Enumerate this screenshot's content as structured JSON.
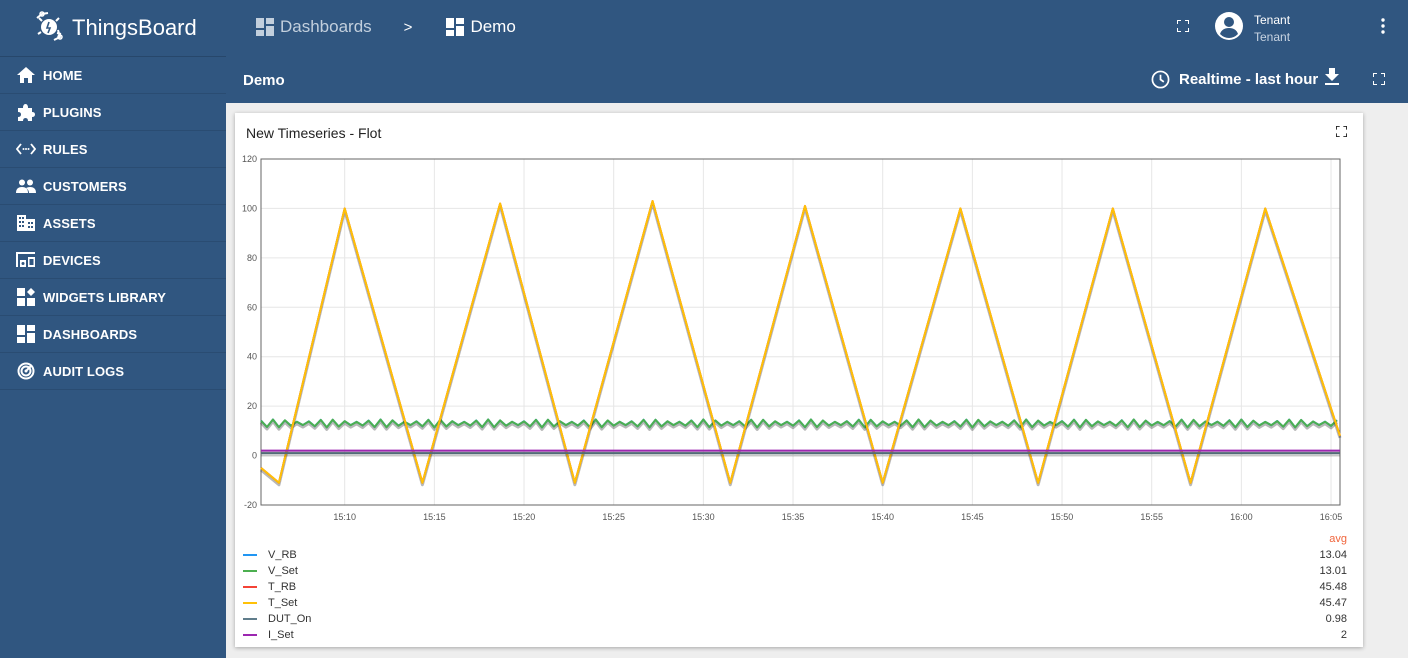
{
  "app": {
    "name": "ThingsBoard"
  },
  "sidebar": {
    "items": [
      {
        "label": "HOME",
        "icon": "home-icon"
      },
      {
        "label": "PLUGINS",
        "icon": "puzzle-icon"
      },
      {
        "label": "RULES",
        "icon": "code-arrows-icon"
      },
      {
        "label": "CUSTOMERS",
        "icon": "people-icon"
      },
      {
        "label": "ASSETS",
        "icon": "building-icon"
      },
      {
        "label": "DEVICES",
        "icon": "devices-icon"
      },
      {
        "label": "WIDGETS LIBRARY",
        "icon": "widgets-icon"
      },
      {
        "label": "DASHBOARDS",
        "icon": "dashboard-icon"
      },
      {
        "label": "AUDIT LOGS",
        "icon": "track-changes-icon"
      }
    ]
  },
  "header": {
    "breadcrumb": [
      {
        "label": "Dashboards"
      },
      {
        "label": "Demo"
      }
    ],
    "breadcrumb_separator": ">",
    "user": {
      "name": "Tenant",
      "role": "Tenant"
    },
    "page_title": "Demo",
    "timewindow": "Realtime - last hour"
  },
  "widget": {
    "title": "New Timeseries - Flot",
    "legend_header": "avg",
    "legend": [
      {
        "name": "V_RB",
        "color": "#2196f3",
        "avg": "13.04"
      },
      {
        "name": "V_Set",
        "color": "#4caf50",
        "avg": "13.01"
      },
      {
        "name": "T_RB",
        "color": "#f44336",
        "avg": "45.48"
      },
      {
        "name": "T_Set",
        "color": "#ffc107",
        "avg": "45.47"
      },
      {
        "name": "DUT_On",
        "color": "#607d8b",
        "avg": "0.98"
      },
      {
        "name": "I_Set",
        "color": "#9c27b0",
        "avg": "2"
      }
    ]
  },
  "chart_data": {
    "type": "line",
    "title": "New Timeseries - Flot",
    "xlabel": "",
    "ylabel": "",
    "x_range": [
      "15:05:20",
      "16:05:30"
    ],
    "ylim": [
      -20,
      120
    ],
    "y_ticks": [
      -20,
      0,
      20,
      40,
      60,
      80,
      100,
      120
    ],
    "x_ticks": [
      "15:10",
      "15:15",
      "15:20",
      "15:25",
      "15:30",
      "15:35",
      "15:40",
      "15:45",
      "15:50",
      "15:55",
      "16:00",
      "16:05"
    ],
    "grid": true,
    "legend_position": "bottom",
    "series": [
      {
        "name": "V_RB",
        "color": "#2196f3",
        "pattern": "oscillating",
        "approx_center": 13,
        "approx_amplitude": 2
      },
      {
        "name": "V_Set",
        "color": "#4caf50",
        "pattern": "oscillating",
        "approx_center": 13,
        "approx_amplitude": 2
      },
      {
        "name": "T_RB",
        "color": "#f44336",
        "pattern": "triangle",
        "points": [
          [
            "15:05:20",
            -5
          ],
          [
            "15:06:20",
            -11
          ],
          [
            "15:10:00",
            100
          ],
          [
            "15:14:20",
            -11
          ],
          [
            "15:18:40",
            102
          ],
          [
            "15:22:50",
            -11
          ],
          [
            "15:27:10",
            103
          ],
          [
            "15:31:30",
            -11
          ],
          [
            "15:35:40",
            101
          ],
          [
            "15:40:00",
            -11
          ],
          [
            "15:44:20",
            100
          ],
          [
            "15:48:40",
            -11
          ],
          [
            "15:52:50",
            100
          ],
          [
            "15:57:10",
            -11
          ],
          [
            "16:01:20",
            100
          ],
          [
            "16:05:30",
            8
          ]
        ]
      },
      {
        "name": "T_Set",
        "color": "#ffc107",
        "pattern": "triangle",
        "points": [
          [
            "15:05:20",
            -5
          ],
          [
            "15:06:20",
            -11
          ],
          [
            "15:10:00",
            100
          ],
          [
            "15:14:20",
            -11
          ],
          [
            "15:18:40",
            102
          ],
          [
            "15:22:50",
            -11
          ],
          [
            "15:27:10",
            103
          ],
          [
            "15:31:30",
            -11
          ],
          [
            "15:35:40",
            101
          ],
          [
            "15:40:00",
            -11
          ],
          [
            "15:44:20",
            100
          ],
          [
            "15:48:40",
            -11
          ],
          [
            "15:52:50",
            100
          ],
          [
            "15:57:10",
            -11
          ],
          [
            "16:01:20",
            100
          ],
          [
            "16:05:30",
            8
          ]
        ]
      },
      {
        "name": "DUT_On",
        "color": "#607d8b",
        "pattern": "constant",
        "value": 1
      },
      {
        "name": "I_Set",
        "color": "#9c27b0",
        "pattern": "constant",
        "value": 2
      }
    ]
  }
}
